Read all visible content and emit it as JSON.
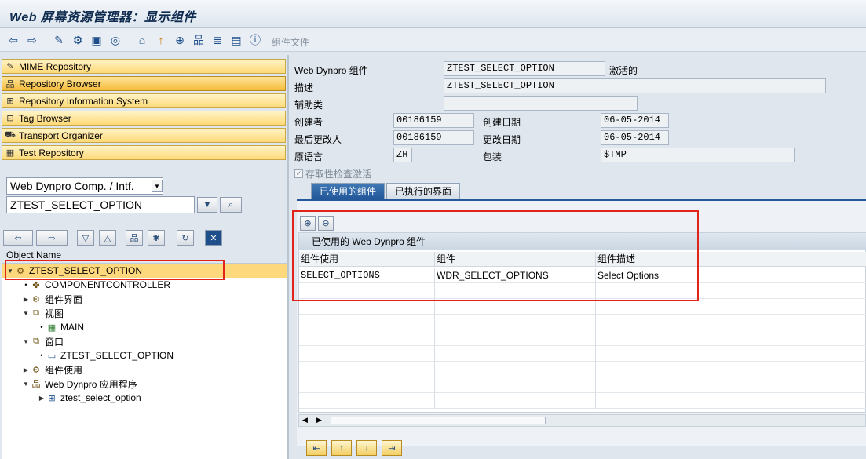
{
  "window": {
    "title": "Web 屏幕资源管理器：显示组件"
  },
  "toolbar": {
    "icons": [
      "back-icon",
      "forward-icon",
      "edit-icon",
      "toggle-icon",
      "other-object-icon",
      "activate-icon",
      "hierarchy-icon",
      "info-icon",
      "where-used-icon",
      "navigate-icon",
      "tree-icon",
      "window-icon",
      "display-icon",
      "help-icon"
    ],
    "component_docs_label": "组件文件"
  },
  "nav": {
    "items": [
      {
        "label": "MIME Repository",
        "icon": "mime-icon"
      },
      {
        "label": "Repository Browser",
        "icon": "browser-icon",
        "active": true
      },
      {
        "label": "Repository Information System",
        "icon": "info-system-icon"
      },
      {
        "label": "Tag Browser",
        "icon": "tag-icon"
      },
      {
        "label": "Transport Organizer",
        "icon": "transport-icon"
      },
      {
        "label": "Test Repository",
        "icon": "test-icon"
      }
    ]
  },
  "object_selector": {
    "type_value": "Web Dynpro Comp. / Intf.",
    "name_value": "ZTEST_SELECT_OPTION"
  },
  "tree": {
    "header": "Object Name",
    "rows": [
      {
        "label": "ZTEST_SELECT_OPTION"
      },
      {
        "label": "COMPONENTCONTROLLER"
      },
      {
        "label": "组件界面"
      },
      {
        "label": "视图"
      },
      {
        "label": "MAIN"
      },
      {
        "label": "窗口"
      },
      {
        "label": "ZTEST_SELECT_OPTION"
      },
      {
        "label": "组件使用"
      },
      {
        "label": "Web Dynpro 应用程序"
      },
      {
        "label": "ztest_select_option"
      }
    ]
  },
  "details": {
    "component_label": "Web Dynpro 组件",
    "component_value": "ZTEST_SELECT_OPTION",
    "status": "激活的",
    "description_label": "描述",
    "description_value": "ZTEST_SELECT_OPTION",
    "helper_class_label": "辅助类",
    "helper_class_value": "",
    "created_by_label": "创建者",
    "created_by_value": "00186159",
    "created_on_label": "创建日期",
    "created_on_value": "06-05-2014",
    "changed_by_label": "最后更改人",
    "changed_by_value": "00186159",
    "changed_on_label": "更改日期",
    "changed_on_value": "06-05-2014",
    "language_label": "原语言",
    "language_value": "ZH",
    "package_label": "包装",
    "package_value": "$TMP",
    "accessibility_label": "存取性检查激活",
    "accessibility_checked": true
  },
  "tabs": [
    {
      "label": "已使用的组件",
      "active": true
    },
    {
      "label": "已执行的界面",
      "active": false
    }
  ],
  "used_components": {
    "title": "已使用的 Web Dynpro 组件",
    "columns": [
      "组件使用",
      "组件",
      "组件描述"
    ],
    "rows": [
      [
        "SELECT_OPTIONS",
        "WDR_SELECT_OPTIONS",
        "Select Options"
      ]
    ]
  }
}
